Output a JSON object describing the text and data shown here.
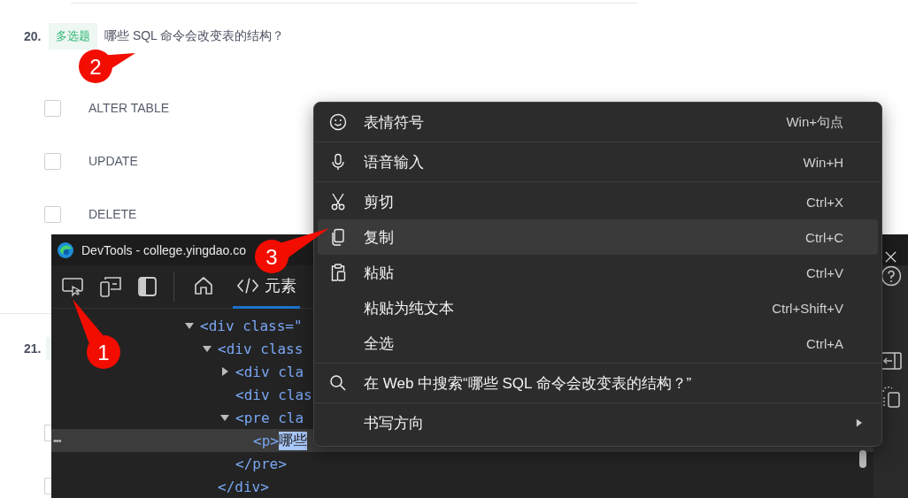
{
  "page": {
    "questions": [
      {
        "number": "20.",
        "tag": "多选题",
        "text": "哪些 SQL 命令会改变表的结构？",
        "options": [
          {
            "label": "ALTER TABLE",
            "checked": false
          },
          {
            "label": "UPDATE",
            "checked": false
          },
          {
            "label": "DELETE",
            "checked": false
          }
        ]
      },
      {
        "number": "21.",
        "options": [
          {
            "checked": false
          },
          {
            "checked": false
          }
        ]
      }
    ]
  },
  "devtools": {
    "title": "DevTools - college.yingdao.co",
    "tabs": [
      {
        "kind": "home",
        "selected": false
      },
      {
        "kind": "elements",
        "label": "元素",
        "selected": true
      }
    ],
    "tree": [
      {
        "text": "<div class=\"",
        "expanded": true,
        "children": [
          {
            "text": "<div class",
            "expanded": true,
            "children": [
              {
                "text": "<div cla",
                "expanded": false
              },
              {
                "text": "<div clas"
              },
              {
                "text": "<pre cla",
                "expanded": true,
                "children": [
                  {
                    "gutter": "•••",
                    "tag": "<p>",
                    "text": "哪些",
                    "selected": true
                  }
                ]
              },
              {
                "text": "</pre>"
              }
            ]
          },
          {
            "text": "</div>"
          }
        ]
      }
    ]
  },
  "context_menu": {
    "groups": [
      [
        {
          "kind": "emoji",
          "label": "表情符号",
          "shortcut": "Win+句点",
          "selected": false
        }
      ],
      [
        {
          "kind": "voice",
          "label": "语音输入",
          "shortcut": "Win+H",
          "selected": false
        }
      ],
      [
        {
          "kind": "cut",
          "label": "剪切",
          "shortcut": "Ctrl+X",
          "selected": false
        },
        {
          "kind": "copy",
          "label": "复制",
          "shortcut": "Ctrl+C",
          "selected": true
        },
        {
          "kind": "paste",
          "label": "粘贴",
          "shortcut": "Ctrl+V",
          "selected": false
        },
        {
          "kind": "plain",
          "label": "粘贴为纯文本",
          "shortcut": "Ctrl+Shift+V",
          "selected": false
        },
        {
          "kind": "plain",
          "label": "全选",
          "shortcut": "Ctrl+A",
          "selected": false
        }
      ],
      [
        {
          "kind": "search",
          "label": "在 Web 中搜索“哪些 SQL 命令会改变表的结构？”",
          "selected": false
        }
      ],
      [
        {
          "kind": "submenu",
          "label": "书写方向",
          "selected": false
        }
      ]
    ]
  },
  "callouts": [
    {
      "number": "1"
    },
    {
      "number": "2"
    },
    {
      "number": "3"
    }
  ]
}
